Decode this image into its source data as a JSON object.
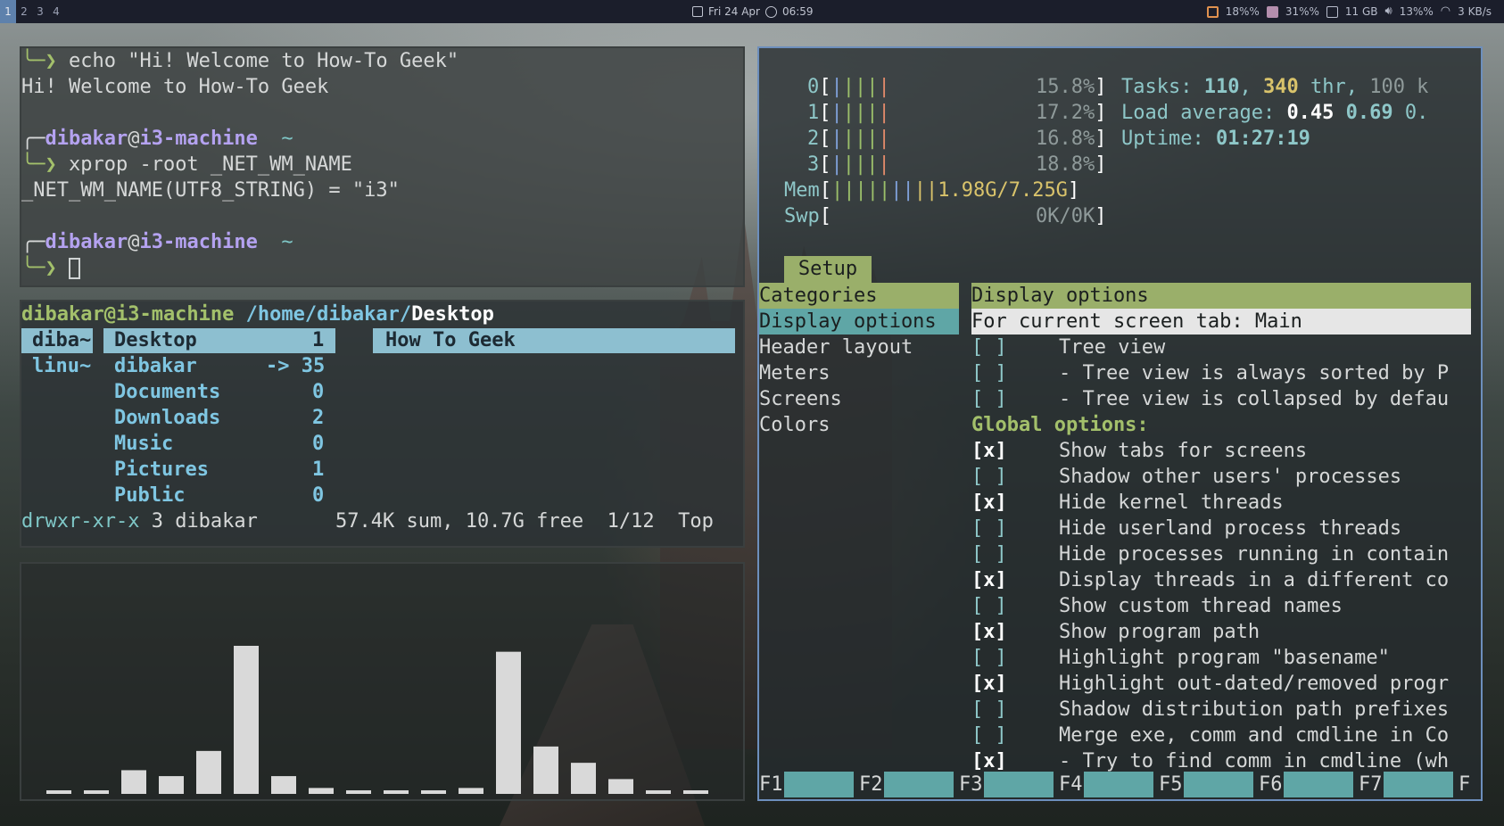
{
  "topbar": {
    "workspaces": [
      "1",
      "2",
      "3",
      "4"
    ],
    "date": "Fri 24 Apr",
    "time": "06:59",
    "cpu": "18%%",
    "mem": "31%%",
    "disk": "11 GB",
    "volume": "13%%",
    "net": "3 KB/s"
  },
  "terminal": {
    "lines": [
      {
        "prefix": "╰─❯ ",
        "text": "echo \"Hi! Welcome to How-To Geek\""
      },
      {
        "prefix": "",
        "text": "Hi! Welcome to How-To Geek"
      },
      {
        "prefix": "",
        "text": ""
      },
      {
        "prefix": "╭─",
        "user": "dibakar",
        "host": "i3-machine",
        "tilde": "  ~"
      },
      {
        "prefix": "╰─❯ ",
        "text": "xprop -root _NET_WM_NAME"
      },
      {
        "prefix": "",
        "text": "_NET_WM_NAME(UTF8_STRING) = \"i3\""
      },
      {
        "prefix": "",
        "text": ""
      },
      {
        "prefix": "╭─",
        "user": "dibakar",
        "host": "i3-machine",
        "tilde": "  ~"
      },
      {
        "prefix": "╰─❯ ",
        "text": ""
      }
    ],
    "at": "@"
  },
  "ranger": {
    "user_host": "dibakar@i3-machine",
    "path": "/home/dibakar/",
    "current": "Desktop",
    "col1": [
      "diba~",
      "linu~"
    ],
    "col2": [
      {
        "name": "Desktop",
        "count": "1"
      },
      {
        "name": "dibakar",
        "count": "-> 35"
      },
      {
        "name": "Documents",
        "count": "0"
      },
      {
        "name": "Downloads",
        "count": "2"
      },
      {
        "name": "Music",
        "count": "0"
      },
      {
        "name": "Pictures",
        "count": "1"
      },
      {
        "name": "Public",
        "count": "0"
      }
    ],
    "preview": "How To Geek",
    "perms": "drwxr-xr-x",
    "owner": "3 dibakar",
    "summary": "57.4K sum, 10.7G free  1/12  Top"
  },
  "bars": {
    "levels": [
      0.02,
      0.02,
      0.16,
      0.12,
      0.29,
      1.0,
      0.12,
      0.04,
      0.02,
      0.02,
      0.02,
      0.04,
      0.96,
      0.32,
      0.21,
      0.1,
      0.02,
      0.02
    ]
  },
  "htop": {
    "cpus": [
      {
        "id": "0",
        "pct": "15.8%"
      },
      {
        "id": "1",
        "pct": "17.2%"
      },
      {
        "id": "2",
        "pct": "16.8%"
      },
      {
        "id": "3",
        "pct": "18.8%"
      }
    ],
    "mem_label": "Mem",
    "mem_value": "1.98G/7.25G",
    "swp_label": "Swp",
    "swp_value": "0K/0K",
    "tasks_label": "Tasks: ",
    "tasks": "110",
    "thr": "340",
    "thr_label": " thr, ",
    "kthr": "100 k",
    "load_label": "Load average: ",
    "load1": "0.45",
    "load5": "0.69",
    "load15": "0.",
    "uptime_label": "Uptime: ",
    "uptime": "01:27:19",
    "setup_tab": "Setup",
    "categories_header": "Categories",
    "categories": [
      "Display options",
      "Header layout",
      "Meters",
      "Screens",
      "Colors"
    ],
    "panel_header": "Display options",
    "panel_sub": "For current screen tab: Main",
    "global_label": "Global options:",
    "options": [
      {
        "check": "[ ]",
        "label": "Tree view",
        "indent": false
      },
      {
        "check": "[ ]",
        "label": "- Tree view is always sorted by P",
        "indent": false
      },
      {
        "check": "[ ]",
        "label": "- Tree view is collapsed by defau",
        "indent": false
      },
      {
        "check": "[x]",
        "label": "Show tabs for screens"
      },
      {
        "check": "[ ]",
        "label": "Shadow other users' processes"
      },
      {
        "check": "[x]",
        "label": "Hide kernel threads"
      },
      {
        "check": "[ ]",
        "label": "Hide userland process threads"
      },
      {
        "check": "[ ]",
        "label": "Hide processes running in contain"
      },
      {
        "check": "[x]",
        "label": "Display threads in a different co"
      },
      {
        "check": "[ ]",
        "label": "Show custom thread names"
      },
      {
        "check": "[x]",
        "label": "Show program path"
      },
      {
        "check": "[ ]",
        "label": "Highlight program \"basename\""
      },
      {
        "check": "[x]",
        "label": "Highlight out-dated/removed progr"
      },
      {
        "check": "[ ]",
        "label": "Shadow distribution path prefixes"
      },
      {
        "check": "[ ]",
        "label": "Merge exe, comm and cmdline in Co"
      },
      {
        "check": "[x]",
        "label": "- Try to find comm in cmdline (wh"
      }
    ],
    "fkeys": [
      "F1",
      "F2",
      "F3",
      "F4",
      "F5",
      "F6",
      "F7",
      "F"
    ]
  }
}
